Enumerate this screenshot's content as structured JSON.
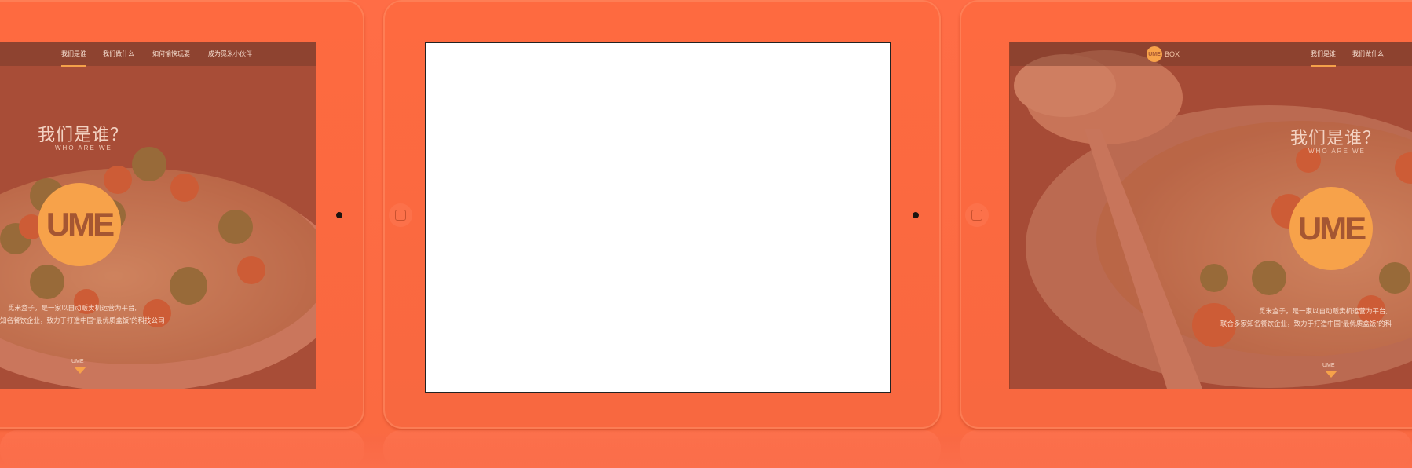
{
  "left": {
    "nav": [
      "我们是谁",
      "我们做什么",
      "如何愉快玩耍",
      "成为觅米小伙伴"
    ],
    "heading": "我们是谁？",
    "sub": "WHO ARE WE",
    "logo": "UME",
    "desc1": "觅米盒子，是一家以自动贩卖机运营为平台,",
    "desc2": "知名餐饮企业，致力于打造中国“最优质盒饭”的科技公司",
    "arrow_label": "UME"
  },
  "right": {
    "brand": "UME",
    "brand_suffix": "BOX",
    "nav": [
      "我们是谁",
      "我们做什么"
    ],
    "heading": "我们是谁？",
    "sub": "WHO ARE WE",
    "logo": "UME",
    "desc1": "觅米盒子，是一家以自动贩卖机运营为平台,",
    "desc2": "联合多家知名餐饮企业，致力于打造中国“最优质盒饭”的科",
    "arrow_label": "UME"
  },
  "colors": {
    "background": "#fb6a41",
    "accent": "#f7a24a",
    "screen": "#ffffff"
  }
}
